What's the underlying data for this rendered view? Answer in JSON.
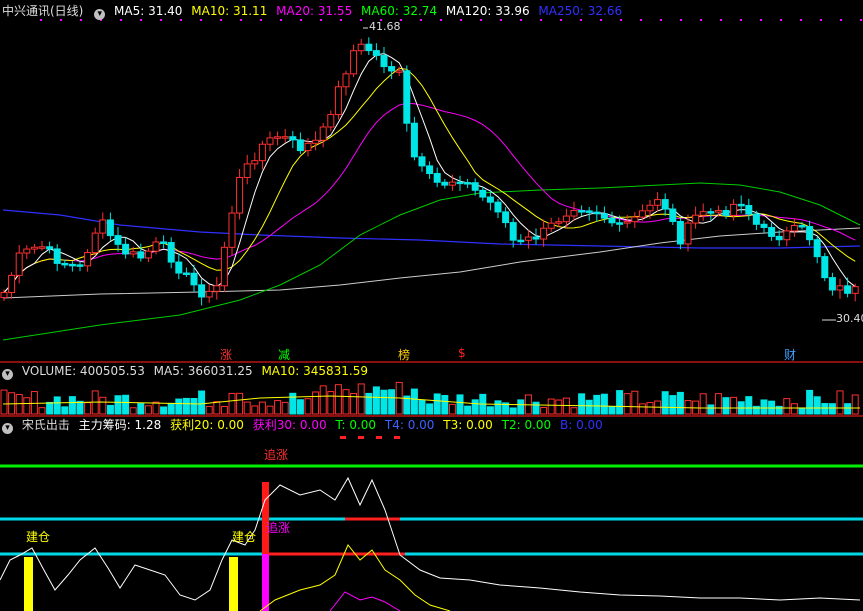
{
  "main_panel": {
    "stock_title": "中兴通讯(日线)",
    "ma_legend": [
      {
        "label": "MA5: 31.40",
        "color": "#ffffff"
      },
      {
        "label": "MA10: 31.11",
        "color": "#ffff00"
      },
      {
        "label": "MA20: 31.55",
        "color": "#ff00ff"
      },
      {
        "label": "MA60: 32.74",
        "color": "#00ff00"
      },
      {
        "label": "MA120: 33.96",
        "color": "#ffffff"
      },
      {
        "label": "MA250: 32.66",
        "color": "#3030ff"
      }
    ],
    "high_label": "41.68",
    "low_label": "30.40",
    "event_markers": [
      {
        "text": "涨",
        "color": "#ff3030"
      },
      {
        "text": "减",
        "color": "#00ff00"
      },
      {
        "text": "榜",
        "color": "#ffcc00"
      },
      {
        "text": "$",
        "color": "#ff2020"
      },
      {
        "text": "财",
        "color": "#40a0ff"
      }
    ]
  },
  "volume_panel": {
    "title": "VOLUME: 400505.53",
    "ma5": "MA5: 366031.25",
    "ma10": "MA10: 345831.59"
  },
  "indicator_panel": {
    "title": "宋氏出击",
    "items": [
      {
        "label": "主力筹码: 1.28",
        "color": "#ffffff"
      },
      {
        "label": "获利20: 0.00",
        "color": "#ffff00"
      },
      {
        "label": "获利30: 0.00",
        "color": "#ff00ff"
      },
      {
        "label": "T: 0.00",
        "color": "#00ff00"
      },
      {
        "label": "T4: 0.00",
        "color": "#4060ff"
      },
      {
        "label": "T3: 0.00",
        "color": "#ffff00"
      },
      {
        "label": "T2: 0.00",
        "color": "#00ff00"
      },
      {
        "label": "B: 0.00",
        "color": "#3030ff"
      }
    ],
    "annotations": {
      "zhuizhang_top": "追涨",
      "zhuizhang_mid": "追涨",
      "jiancang_1": "建仓",
      "jiancang_2": "建仓"
    }
  },
  "icons": {
    "collapse": "circle-chevron-icon"
  },
  "colors": {
    "up": "#ff3030",
    "down": "#00e5e5",
    "separator": "#8a1010"
  }
}
